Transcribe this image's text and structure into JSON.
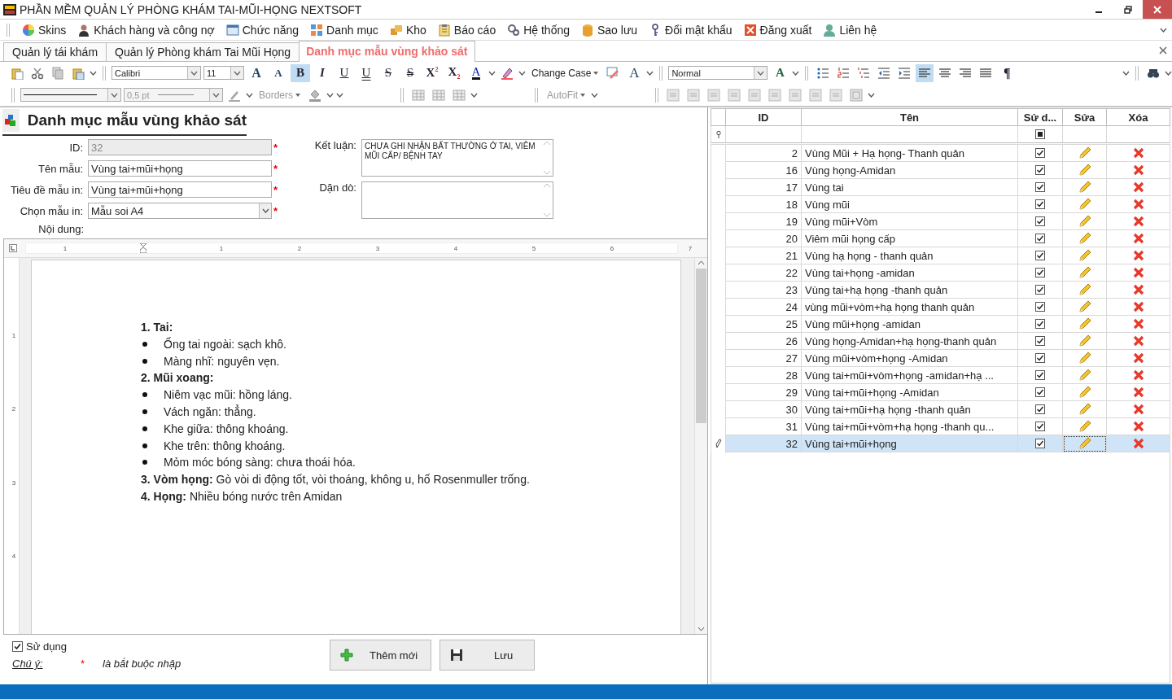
{
  "window": {
    "title": "PHẦN MỀM QUẢN LÝ PHÒNG KHÁM TAI-MŨI-HỌNG NEXTSOFT"
  },
  "menu": [
    {
      "label": "Skins",
      "kind": "palette"
    },
    {
      "label": "Khách hàng và công nợ",
      "kind": "person"
    },
    {
      "label": "Chức năng",
      "kind": "window"
    },
    {
      "label": "Danh mục",
      "kind": "grid"
    },
    {
      "label": "Kho",
      "kind": "boxes"
    },
    {
      "label": "Báo cáo",
      "kind": "clipboard"
    },
    {
      "label": "Hệ thống",
      "kind": "gears"
    },
    {
      "label": "Sao lưu",
      "kind": "database"
    },
    {
      "label": "Đổi mật khẩu",
      "kind": "key"
    },
    {
      "label": "Đăng xuất",
      "kind": "logout"
    },
    {
      "label": "Liên hệ",
      "kind": "contact"
    }
  ],
  "tabs": [
    {
      "label": "Quản lý tái khám",
      "selected": false
    },
    {
      "label": "Quản lý Phòng khám Tai Mũi Họng",
      "selected": false
    },
    {
      "label": "Danh mục mẫu vùng khảo sát",
      "selected": true
    }
  ],
  "toolbar": {
    "row1": [
      {
        "kind": "paste"
      },
      {
        "kind": "cut"
      },
      {
        "kind": "copy"
      },
      {
        "kind": "paste-special"
      },
      {
        "kind": "caret"
      },
      {
        "kind": "sep"
      },
      {
        "kind": "font-combo",
        "label": "Calibri"
      },
      {
        "kind": "size-combo",
        "label": "11"
      },
      {
        "kind": "grow-font",
        "label": "A",
        "selected": false
      },
      {
        "kind": "shrink-font",
        "label": "A",
        "selected": false
      },
      {
        "kind": "bold",
        "label": "B",
        "selected": true
      },
      {
        "kind": "italic",
        "label": "I",
        "selected": false
      },
      {
        "kind": "underline",
        "label": "U",
        "selected": false
      },
      {
        "kind": "double-underline",
        "label": "U",
        "selected": false
      },
      {
        "kind": "strike",
        "label": "S",
        "selected": false
      },
      {
        "kind": "double-strike",
        "label": "S",
        "selected": false
      },
      {
        "kind": "superscript",
        "label": "X$^{2}$",
        "selected": false
      },
      {
        "kind": "subscript",
        "label": "X$_{2}$",
        "selected": false
      },
      {
        "kind": "font-color",
        "label": "A",
        "selected": false
      },
      {
        "kind": "caret"
      },
      {
        "kind": "highlight"
      },
      {
        "kind": "caret"
      },
      {
        "kind": "text-dropdown",
        "label": "Change Case"
      },
      {
        "kind": "spell"
      },
      {
        "kind": "clear-format",
        "label": "A",
        "selected": false
      },
      {
        "kind": "caret"
      },
      {
        "kind": "sep"
      },
      {
        "kind": "style-combo",
        "label": "Normal"
      },
      {
        "kind": "styles",
        "label": "A",
        "selected": false
      },
      {
        "kind": "caret"
      },
      {
        "kind": "sep"
      },
      {
        "kind": "bullets"
      },
      {
        "kind": "numbering"
      },
      {
        "kind": "multilevel"
      },
      {
        "kind": "outdent"
      },
      {
        "kind": "indent"
      },
      {
        "kind": "align-left",
        "selected": true
      },
      {
        "kind": "align-center",
        "selected": false
      },
      {
        "kind": "align-right",
        "selected": false
      },
      {
        "kind": "justify",
        "selected": false
      },
      {
        "kind": "paragraph",
        "label": "¶",
        "selected": false
      },
      {
        "kind": "spacer"
      },
      {
        "kind": "caret"
      },
      {
        "kind": "sep"
      },
      {
        "kind": "find"
      },
      {
        "kind": "caret"
      }
    ],
    "row2": [
      {
        "kind": "sep"
      },
      {
        "kind": "line-combo"
      },
      {
        "kind": "weight-combo",
        "label": "0,5 pt"
      },
      {
        "kind": "pen"
      },
      {
        "kind": "caret"
      },
      {
        "kind": "text-dropdown",
        "label": "Borders"
      },
      {
        "kind": "shading"
      },
      {
        "kind": "caret"
      },
      {
        "kind": "caret"
      },
      {
        "kind": "gap"
      },
      {
        "kind": "sep"
      },
      {
        "kind": "table"
      },
      {
        "kind": "table"
      },
      {
        "kind": "table"
      },
      {
        "kind": "caret"
      },
      {
        "kind": "gap"
      },
      {
        "kind": "sep"
      },
      {
        "kind": "text-dropdown",
        "label": "AutoFit"
      },
      {
        "kind": "caret"
      },
      {
        "kind": "gap"
      },
      {
        "kind": "sep"
      },
      {
        "kind": "cell-align"
      },
      {
        "kind": "cell-align"
      },
      {
        "kind": "cell-align"
      },
      {
        "kind": "cell-align"
      },
      {
        "kind": "cell-align"
      },
      {
        "kind": "cell-align"
      },
      {
        "kind": "cell-align"
      },
      {
        "kind": "cell-align"
      },
      {
        "kind": "cell-align"
      },
      {
        "kind": "cell-margins"
      },
      {
        "kind": "caret"
      }
    ]
  },
  "form": {
    "heading": "Danh mục mẫu vùng khảo sát",
    "fields": [
      {
        "label": "ID:",
        "value": "32",
        "kind": "readonly"
      },
      {
        "label": "Tên mẫu:",
        "value": "Vùng tai+mũi+họng",
        "kind": "text"
      },
      {
        "label": "Tiêu đề mẫu in:",
        "value": "Vùng tai+mũi+họng",
        "kind": "text"
      },
      {
        "label": "Chọn mẫu in:",
        "value": "Mẫu soi A4",
        "kind": "combo"
      }
    ],
    "required_mark": "*",
    "conclusion": {
      "label": "Kết luận:",
      "value": "CHƯA GHI NHẬN BẤT THƯỜNG Ở TAI, VIÊM MŨI CẤP/ BỆNH TAY"
    },
    "advice": {
      "label": "Dặn dò:"
    },
    "content_label": "Nội dung:"
  },
  "ruler": {
    "marks": [
      "1",
      "1",
      "2",
      "3",
      "4",
      "5",
      "6",
      "7"
    ],
    "vertical_marks": [
      "1",
      "2",
      "3",
      "4"
    ]
  },
  "document": [
    {
      "kind": "heading",
      "text": "1. Tai:"
    },
    {
      "kind": "bullet",
      "text": "Ống tai ngoài: sạch khô."
    },
    {
      "kind": "bullet",
      "text": "Màng nhĩ: nguyên vẹn."
    },
    {
      "kind": "heading",
      "text": "2. Mũi xoang:"
    },
    {
      "kind": "bullet",
      "text": "Niêm vạc mũi: hồng láng."
    },
    {
      "kind": "bullet",
      "text": "Vách ngăn: thẳng."
    },
    {
      "kind": "bullet",
      "text": "Khe giữa: thông khoáng."
    },
    {
      "kind": "bullet",
      "text": "Khe trên: thông khoáng."
    },
    {
      "kind": "bullet",
      "text": "Mỏm móc bóng sàng: chưa thoái hóa."
    },
    {
      "kind": "paragraph",
      "text": "**3. Vòm họng:** Gò vòi di động tốt, vòi thoáng, không u, hố Rosenmuller trống."
    },
    {
      "kind": "paragraph",
      "text": "**4. Họng:** Nhiều bóng nước trên Amidan"
    }
  ],
  "footer": {
    "in_use": {
      "label": "Sử dụng",
      "checked": true
    },
    "note_label": "Chú ý:",
    "note_mark": "*",
    "note_text": "là bắt buộc nhập",
    "buttons": [
      {
        "label": "Thêm mới",
        "kind": "add"
      },
      {
        "label": "Lưu",
        "kind": "save"
      }
    ]
  },
  "grid": {
    "columns": [
      "ID",
      "Tên",
      "Sử d...",
      "Sửa",
      "Xóa"
    ],
    "filter_indeterminate": true,
    "rows": [
      {
        "id": "2",
        "name": "Vùng Mũi + Hạ họng- Thanh quản",
        "in_use": true,
        "selected": false
      },
      {
        "id": "16",
        "name": "Vùng họng-Amidan",
        "in_use": true,
        "selected": false
      },
      {
        "id": "17",
        "name": "Vùng tai",
        "in_use": true,
        "selected": false
      },
      {
        "id": "18",
        "name": "Vùng mũi",
        "in_use": true,
        "selected": false
      },
      {
        "id": "19",
        "name": "Vùng mũi+Vòm",
        "in_use": true,
        "selected": false
      },
      {
        "id": "20",
        "name": "Viêm mũi họng cấp",
        "in_use": true,
        "selected": false
      },
      {
        "id": "21",
        "name": "Vùng hạ họng - thanh quản",
        "in_use": true,
        "selected": false
      },
      {
        "id": "22",
        "name": "Vùng tai+họng -amidan",
        "in_use": true,
        "selected": false
      },
      {
        "id": "23",
        "name": "Vùng tai+hạ họng -thanh quản",
        "in_use": true,
        "selected": false
      },
      {
        "id": "24",
        "name": "vùng mũi+vòm+hạ họng thanh quản",
        "in_use": true,
        "selected": false
      },
      {
        "id": "25",
        "name": "Vùng mũi+họng -amidan",
        "in_use": true,
        "selected": false
      },
      {
        "id": "26",
        "name": "Vùng họng-Amidan+hạ họng-thanh quản",
        "in_use": true,
        "selected": false
      },
      {
        "id": "27",
        "name": "Vùng mũi+vòm+họng -Amidan",
        "in_use": true,
        "selected": false
      },
      {
        "id": "28",
        "name": "Vùng tai+mũi+vòm+họng -amidan+hạ ...",
        "in_use": true,
        "selected": false
      },
      {
        "id": "29",
        "name": "Vùng tai+mũi+họng -Amidan",
        "in_use": true,
        "selected": false
      },
      {
        "id": "30",
        "name": "Vùng tai+mũi+hạ họng -thanh quản",
        "in_use": true,
        "selected": false
      },
      {
        "id": "31",
        "name": "Vùng tai+mũi+vòm+hạ họng -thanh qu...",
        "in_use": true,
        "selected": false
      },
      {
        "id": "32",
        "name": "Vùng tai+mũi+họng",
        "in_use": true,
        "selected": true
      }
    ]
  }
}
